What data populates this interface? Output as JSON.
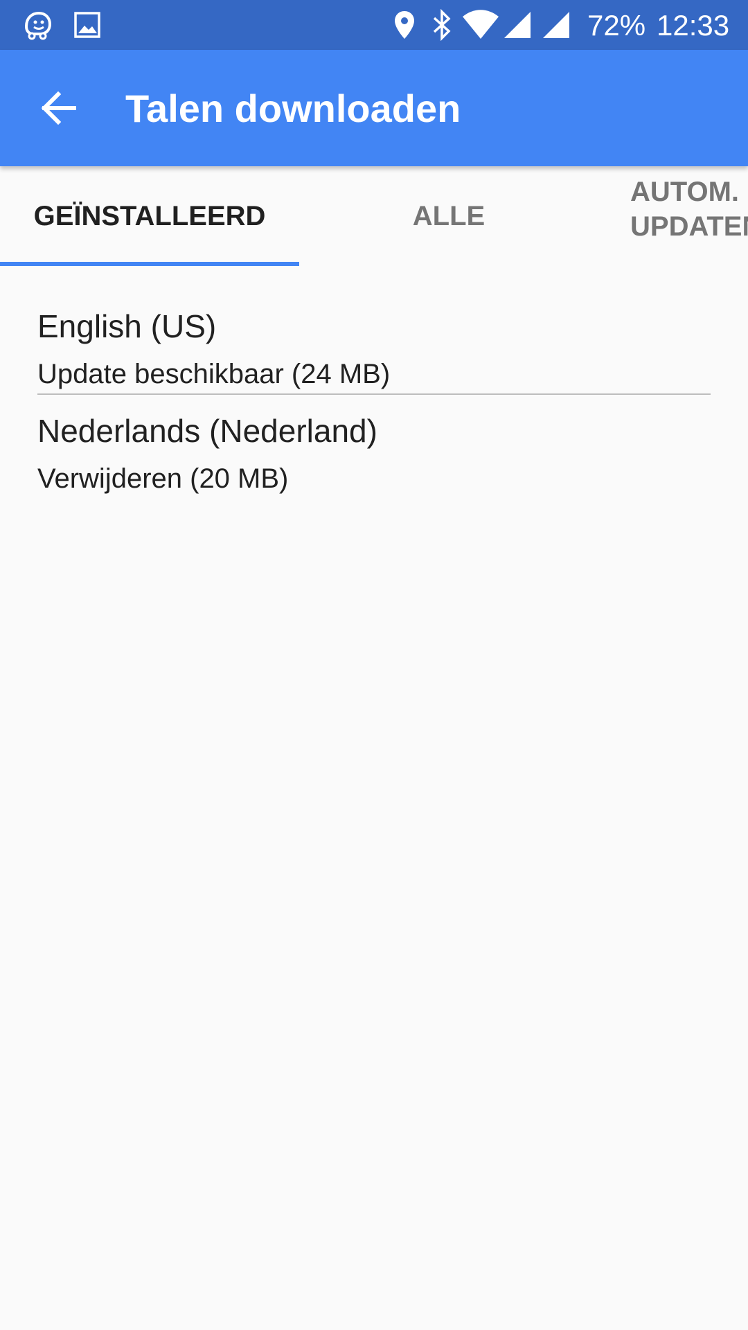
{
  "status_bar": {
    "icons_left": [
      "waze-icon",
      "image-icon"
    ],
    "icons_right": [
      "location-icon",
      "bluetooth-icon",
      "wifi-icon",
      "signal-icon",
      "signal-icon"
    ],
    "battery": "72%",
    "time": "12:33"
  },
  "app_bar": {
    "back_icon": "arrow-left-icon",
    "title": "Talen downloaden"
  },
  "tabs": [
    {
      "label": "GEÏNSTALLEERD",
      "selected": true
    },
    {
      "label": "ALLE",
      "selected": false
    },
    {
      "label_line1": "AUTOM.",
      "label_line2": "UPDATEN",
      "selected": false
    }
  ],
  "languages": [
    {
      "name": "English (US)",
      "status": "Update beschikbaar (24 MB)"
    },
    {
      "name": "Nederlands (Nederland)",
      "status": "Verwijderen (20 MB)"
    }
  ],
  "colors": {
    "status_bar": "#3568c4",
    "app_bar": "#4285f4",
    "accent": "#4285f4",
    "background": "#fafafa"
  }
}
